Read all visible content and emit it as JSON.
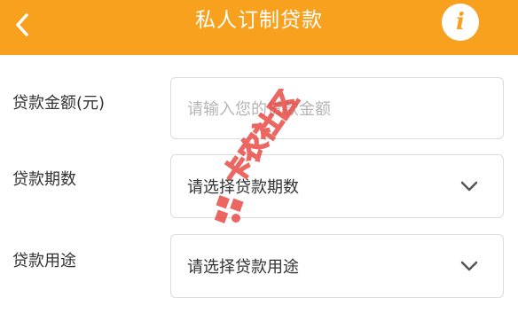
{
  "header": {
    "title": "私人订制贷款",
    "back_icon": "chevron-left-icon",
    "info_icon": "info-icon",
    "info_glyph": "i"
  },
  "form": {
    "amount": {
      "label": "贷款金额(元)",
      "placeholder": "请输入您的贷款金额"
    },
    "periods": {
      "label": "贷款期数",
      "value": "请选择贷款期数",
      "icon": "chevron-down-icon"
    },
    "purpose": {
      "label": "贷款用途",
      "value": "请选择贷款用途",
      "icon": "chevron-down-icon"
    }
  },
  "watermark": {
    "text": "卡农社区"
  },
  "colors": {
    "accent": "#f7a11e",
    "watermark": "#e8403b"
  }
}
